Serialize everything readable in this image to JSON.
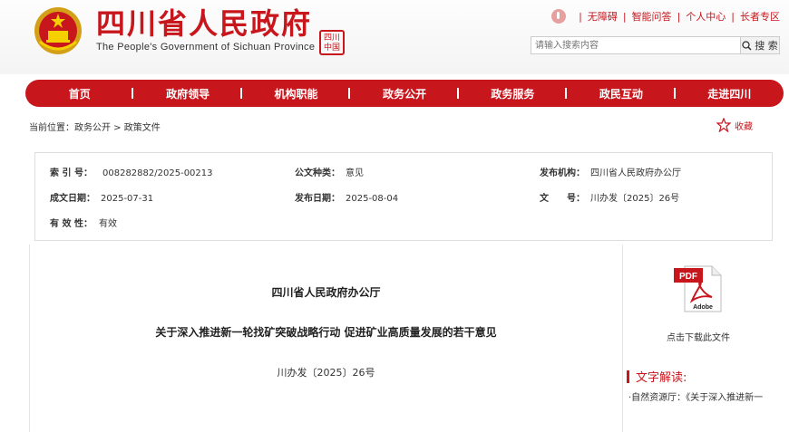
{
  "header": {
    "title": "四川省人民政府",
    "subtitle": "The People's Government of Sichuan Province",
    "seal_text": "四川中国",
    "links": [
      "无障碍",
      "智能问答",
      "个人中心",
      "长者专区"
    ],
    "search_placeholder": "请输入搜索内容",
    "search_button": "搜 索"
  },
  "nav": {
    "items": [
      "首页",
      "政府领导",
      "机构职能",
      "政务公开",
      "政务服务",
      "政民互动",
      "走进四川"
    ]
  },
  "breadcrumb": "当前位置：政务公开 > 政策文件",
  "favorite_label": "收藏",
  "meta": {
    "index_label": "索 引 号：",
    "index_value": "008282882/2025-00213",
    "type_label": "公文种类：",
    "type_value": "意见",
    "publisher_label": "发布机构：",
    "publisher_value": "四川省人民政府办公厅",
    "written_label": "成文日期：",
    "written_value": "2025-07-31",
    "published_label": "发布日期：",
    "published_value": "2025-08-04",
    "docno_label": "文　　号：",
    "docno_value": "川办发〔2025〕26号",
    "validity_label": "有 效 性：",
    "validity_value": "有效"
  },
  "document": {
    "org": "四川省人民政府办公厅",
    "title": "关于深入推进新一轮找矿突破战略行动 促进矿业高质量发展的若干意见",
    "number": "川办发〔2025〕26号"
  },
  "sidebar": {
    "pdf_label": "PDF",
    "adobe_label": "Adobe",
    "download_label": "点击下载此文件",
    "interp_title": "文字解读:",
    "interp_link": "·自然资源厅：《关于深入推进新一"
  },
  "colors": {
    "brand_red": "#c8161d"
  }
}
